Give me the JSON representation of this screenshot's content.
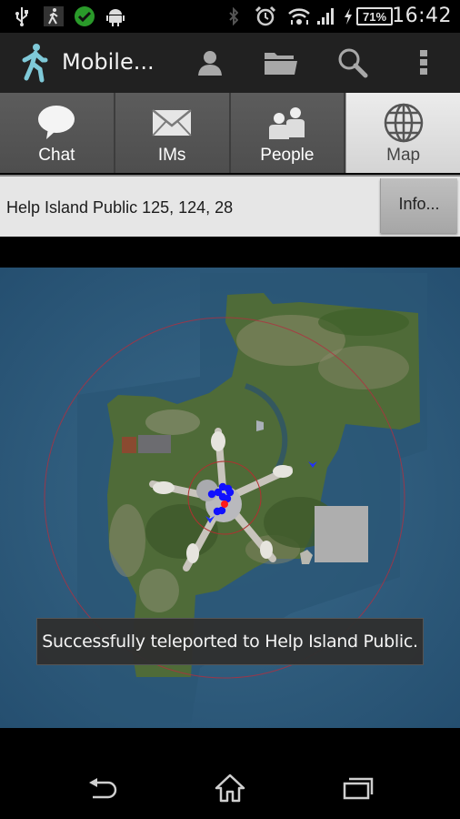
{
  "status_bar": {
    "left_icons": [
      "usb-icon",
      "app-walker-icon",
      "check-icon",
      "android-icon"
    ],
    "right_icons": [
      "bluetooth-icon",
      "alarm-icon",
      "wifi-icon",
      "signal-icon",
      "charging-icon"
    ],
    "battery_percent": "71%",
    "time": "16:42"
  },
  "action_bar": {
    "title": "Mobile...",
    "actions": [
      {
        "name": "profile",
        "icon": "person-icon"
      },
      {
        "name": "inventory",
        "icon": "folder-icon"
      },
      {
        "name": "search",
        "icon": "search-icon"
      },
      {
        "name": "overflow",
        "icon": "more-vertical-icon"
      }
    ]
  },
  "tabs": [
    {
      "label": "Chat",
      "icon": "chat-bubble-icon",
      "active": false
    },
    {
      "label": "IMs",
      "icon": "envelope-icon",
      "active": false
    },
    {
      "label": "People",
      "icon": "people-icon",
      "active": false
    },
    {
      "label": "Map",
      "icon": "globe-icon",
      "active": true
    }
  ],
  "location": {
    "text": "Help Island Public 125, 124, 28",
    "info_button": "Info..."
  },
  "map": {
    "region": "Help Island Public",
    "colors": {
      "water": "#2d5a7c",
      "land": "#4c6a35",
      "self_marker": "#ff1a1a",
      "avatar_marker": "#1010ff",
      "range_circle": "#b03030"
    },
    "avatar_count": 9
  },
  "toast": {
    "message": "Successfully teleported to Help Island Public."
  },
  "nav_bar": {
    "buttons": [
      "back",
      "home",
      "recent-apps"
    ]
  }
}
